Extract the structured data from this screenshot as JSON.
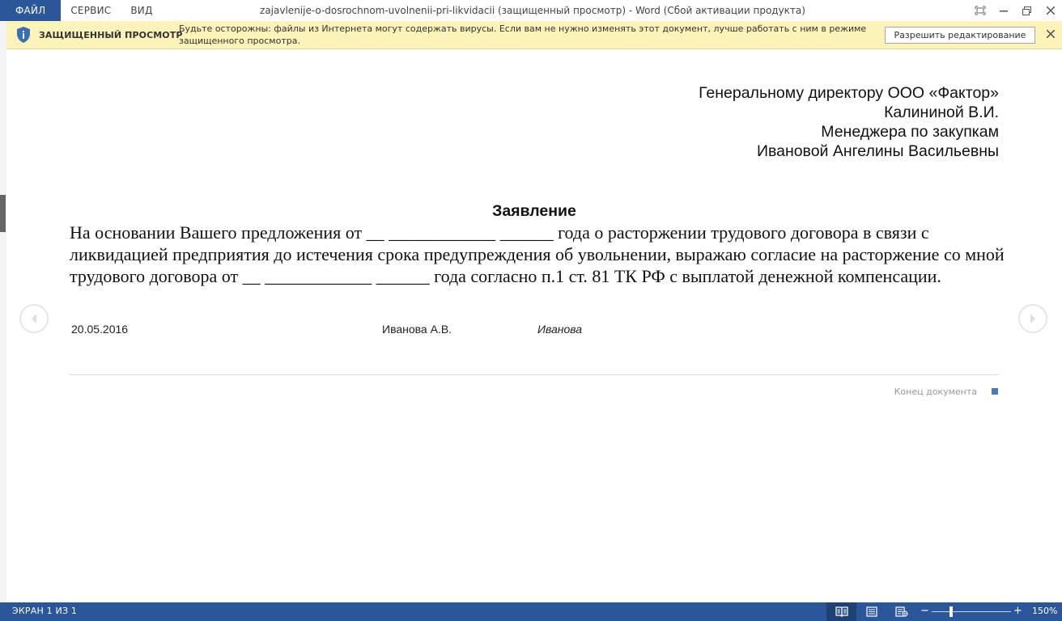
{
  "menu": {
    "items": [
      {
        "label": "ФАЙЛ",
        "active": true
      },
      {
        "label": "СЕРВИС",
        "active": false
      },
      {
        "label": "ВИД",
        "active": false
      }
    ]
  },
  "window": {
    "title": "zajavlenije-o-dosrochnom-uvolnenii-pri-likvidacii (защищенный просмотр) - Word (Сбой активации продукта)"
  },
  "protected_view": {
    "title": "ЗАЩИЩЕННЫЙ ПРОСМОТР",
    "message": "Будьте осторожны: файлы из Интернета могут содержать вирусы. Если вам не нужно изменять этот документ, лучше работать с ним в режиме защищенного просмотра.",
    "enable_button": "Разрешить редактирование",
    "background": "#fcf3b9"
  },
  "document": {
    "addressee": [
      "Генеральному директору ООО «Фактор»",
      "Калининой В.И.",
      "Менеджера по закупкам",
      "Ивановой Ангелины Васильевны"
    ],
    "heading": "Заявление",
    "body": "На основании Вашего предложения от __ ____________ ______ года о расторжении трудового договора в связи с ликвидацией предприятия до истечения срока предупреждения об увольнении, выражаю согласие на расторжение со мной трудового договора от __ ____________ ______ года согласно п.1 ст. 81 ТК РФ с выплатой денежной компенсации.",
    "date": "20.05.2016",
    "name": "Иванова А.В.",
    "signature": "Иванова",
    "end_label": "Конец документа"
  },
  "status": {
    "page": "ЭКРАН 1 ИЗ 1",
    "zoom_minus": "−",
    "zoom_plus": "+",
    "zoom_level": "150%",
    "accent": "#2b579a"
  },
  "icons": {
    "shield": "shield-icon",
    "prev": "chevron-left-icon",
    "next": "chevron-right-icon",
    "read_mode": "read-mode-icon",
    "print_layout": "print-layout-icon",
    "web_layout": "web-layout-icon"
  }
}
